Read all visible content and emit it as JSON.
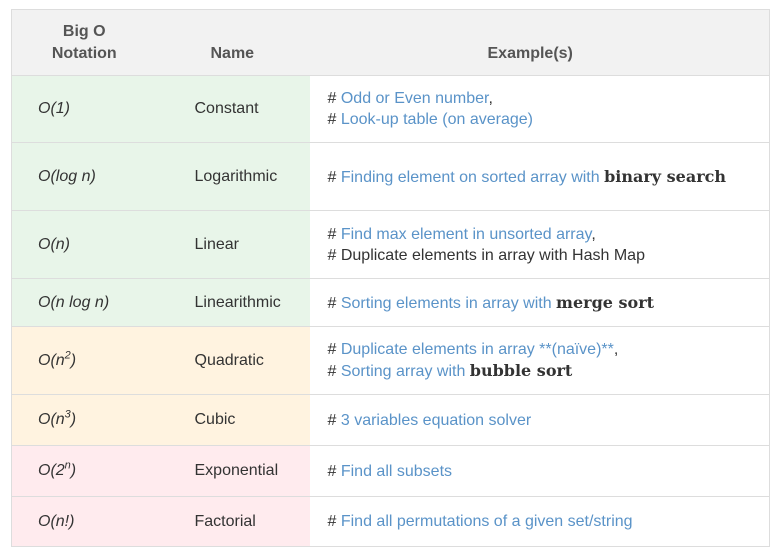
{
  "headers": {
    "notation_line1": "Big O",
    "notation_line2": "Notation",
    "name": "Name",
    "examples": "Example(s)"
  },
  "colors": {
    "green": "#e8f5e9",
    "orange": "#fff3e0",
    "red": "#ffebee",
    "link": "#5a93c8"
  },
  "rows": [
    {
      "notation": "O(1)",
      "name": "Constant",
      "ex1_hash": "# ",
      "ex1_link": "Odd or Even number",
      "ex1_tail": ",",
      "ex2_hash": "# ",
      "ex2_link": "Look-up table (on average)"
    },
    {
      "notation": "O(log n)",
      "name": "Logarithmic",
      "ex1_hash": "# ",
      "ex1_link": "Finding element on sorted array with ",
      "ex1_bold": "binary search"
    },
    {
      "notation": "O(n)",
      "name": "Linear",
      "ex1_hash": "# ",
      "ex1_link": "Find max element in unsorted array",
      "ex1_tail": ",",
      "ex2_text": "# Duplicate elements in array with Hash Map"
    },
    {
      "notation": "O(n log n)",
      "name": "Linearithmic",
      "ex1_hash": "# ",
      "ex1_link": "Sorting elements in array with ",
      "ex1_bold": "merge sort"
    },
    {
      "notation_base": "O(n",
      "notation_sup": "2",
      "notation_end": ")",
      "name": "Quadratic",
      "ex1_hash": "# ",
      "ex1_link": "Duplicate elements in array **(naïve)**",
      "ex1_tail": ",",
      "ex2_hash": "# ",
      "ex2_link": "Sorting array with ",
      "ex2_bold": "bubble sort"
    },
    {
      "notation_base": "O(n",
      "notation_sup": "3",
      "notation_end": ")",
      "name": "Cubic",
      "ex1_hash": "# ",
      "ex1_link": "3 variables equation solver"
    },
    {
      "notation_base": "O(2",
      "notation_sup": "n",
      "notation_end": ")",
      "name": "Exponential",
      "ex1_hash": "# ",
      "ex1_link": "Find all subsets"
    },
    {
      "notation": "O(n!)",
      "name": "Factorial",
      "ex1_hash": "# ",
      "ex1_link": "Find all permutations of a given set/string"
    }
  ]
}
